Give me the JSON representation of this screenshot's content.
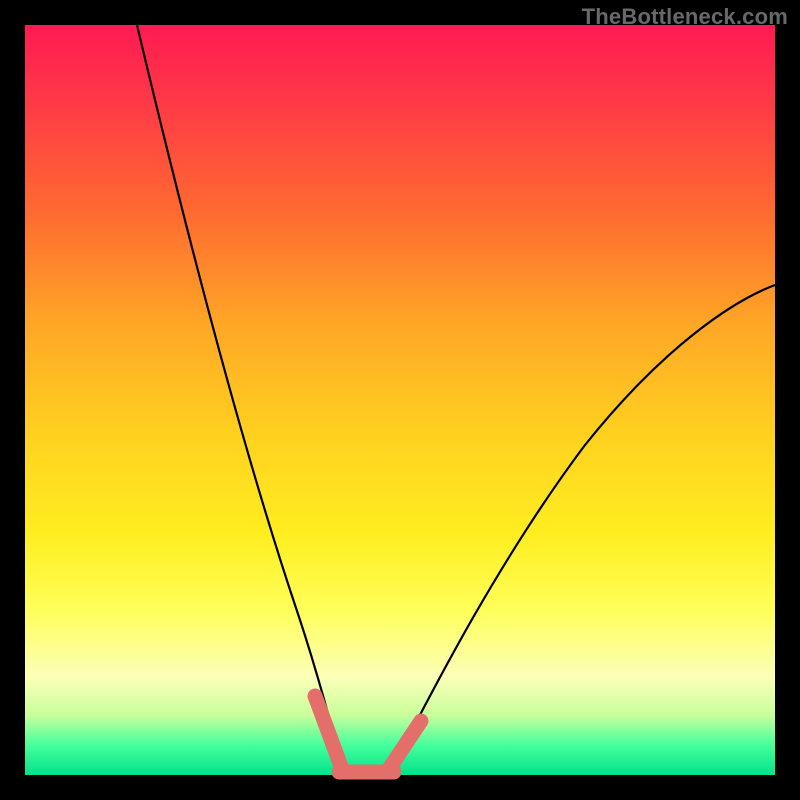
{
  "attribution": "TheBottleneck.com",
  "chart_data": {
    "type": "line",
    "title": "",
    "xlabel": "",
    "ylabel": "",
    "xlim": [
      0,
      100
    ],
    "ylim": [
      0,
      100
    ],
    "series": [
      {
        "name": "left-curve",
        "x": [
          15,
          18,
          21,
          24,
          27,
          30,
          33,
          36,
          38.5,
          40.5,
          42
        ],
        "y": [
          100,
          88,
          76,
          64,
          53,
          42,
          31,
          20,
          11,
          5,
          1
        ]
      },
      {
        "name": "right-curve",
        "x": [
          49,
          51,
          54,
          58,
          63,
          69,
          76,
          83,
          90,
          96,
          100
        ],
        "y": [
          1,
          4,
          9,
          16,
          24,
          33,
          42,
          50,
          57,
          62,
          65
        ]
      },
      {
        "name": "left-marker-segment",
        "x": [
          38.6,
          42.2
        ],
        "y": [
          10.5,
          0.8
        ]
      },
      {
        "name": "right-marker-segment",
        "x": [
          48.6,
          52.8
        ],
        "y": [
          0.8,
          7.2
        ]
      },
      {
        "name": "bottom-marker-segment",
        "x": [
          41.8,
          49.2
        ],
        "y": [
          0.4,
          0.4
        ]
      }
    ],
    "marker_color": "#e46f6a",
    "curve_color": "#000000"
  }
}
